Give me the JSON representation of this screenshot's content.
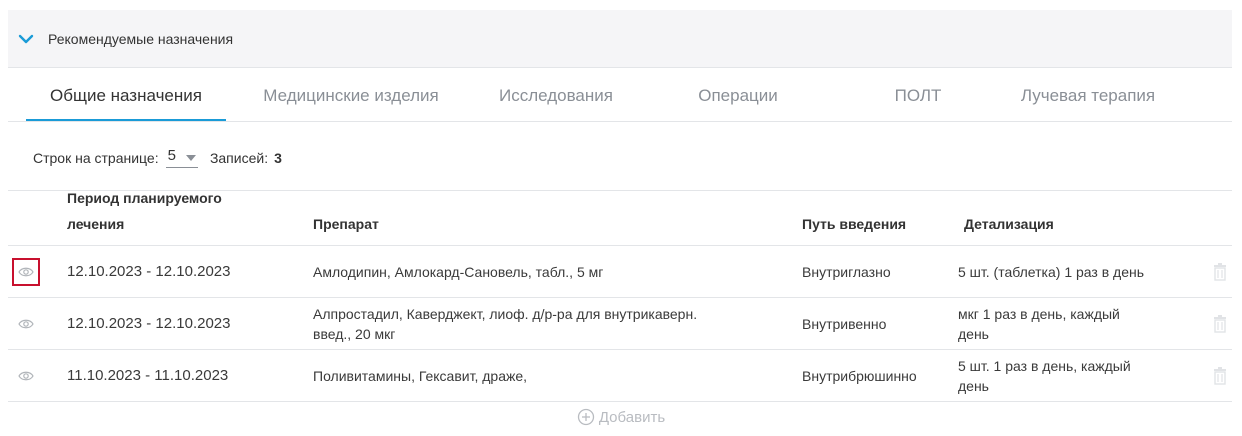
{
  "section": {
    "title": "Рекомендуемые назначения"
  },
  "tabs": [
    {
      "label": "Общие назначения"
    },
    {
      "label": "Медицинские изделия"
    },
    {
      "label": "Исследования"
    },
    {
      "label": "Операции"
    },
    {
      "label": "ПОЛТ"
    },
    {
      "label": "Лучевая терапия"
    }
  ],
  "active_tab": "Общие назначения",
  "pager": {
    "rows_label": "Строк на странице:",
    "rows_value": "5",
    "records_label": "Записей:",
    "records_count": "3"
  },
  "table": {
    "headers": {
      "period_line1": "Период планируемого",
      "period_line2": "лечения",
      "drug": "Препарат",
      "route": "Путь введения",
      "detail": "Детализация"
    },
    "rows": [
      {
        "period": "12.10.2023 - 12.10.2023",
        "drug_line1": "Амлодипин, Амлокард-Сановель, табл., 5 мг",
        "drug_line2": "",
        "route": "Внутриглазно",
        "detail_line1": "5 шт. (таблетка) 1 раз в день",
        "detail_line2": ""
      },
      {
        "period": "12.10.2023 - 12.10.2023",
        "drug_line1": "Алпростадил, Каверджект, лиоф. д/р-ра для внутрикаверн.",
        "drug_line2": "введ., 20 мкг",
        "route": "Внутривенно",
        "detail_line1": "мкг 1 раз в день, каждый",
        "detail_line2": "день"
      },
      {
        "period": "11.10.2023 - 11.10.2023",
        "drug_line1": "Поливитамины, Гексавит, драже,",
        "drug_line2": "",
        "route": "Внутрибрюшинно",
        "detail_line1": "5 шт. 1 раз в день, каждый",
        "detail_line2": "день"
      }
    ]
  },
  "add_button": {
    "label": "Добавить"
  },
  "icons": {
    "chevron": "chevron-down-icon",
    "row_view": "eye-icon",
    "row_delete": "trash-icon",
    "add": "plus-circle-icon"
  },
  "colors": {
    "accent": "#1a9bd7",
    "highlight": "#c8102e",
    "muted": "#b9bcc1"
  }
}
